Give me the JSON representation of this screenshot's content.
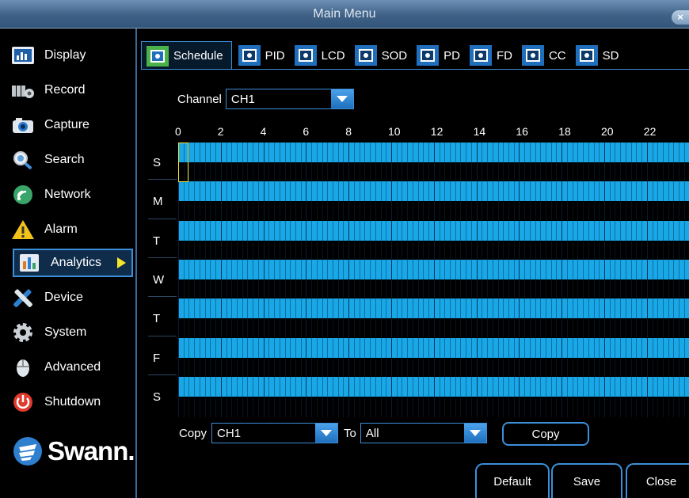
{
  "window": {
    "title": "Main Menu",
    "close_label": "×"
  },
  "sidebar": {
    "items": [
      {
        "label": "Display",
        "icon": "display-icon"
      },
      {
        "label": "Record",
        "icon": "record-icon"
      },
      {
        "label": "Capture",
        "icon": "camera-icon"
      },
      {
        "label": "Search",
        "icon": "search-icon"
      },
      {
        "label": "Network",
        "icon": "network-icon"
      },
      {
        "label": "Alarm",
        "icon": "alarm-icon"
      },
      {
        "label": "Analytics",
        "icon": "analytics-icon",
        "active": true
      },
      {
        "label": "Device",
        "icon": "tools-icon"
      },
      {
        "label": "System",
        "icon": "gear-icon"
      },
      {
        "label": "Advanced",
        "icon": "mouse-icon"
      },
      {
        "label": "Shutdown",
        "icon": "power-icon"
      }
    ],
    "logo_text": "Swann",
    "logo_suffix": "."
  },
  "tabs": [
    {
      "label": "Schedule",
      "active": true
    },
    {
      "label": "PID"
    },
    {
      "label": "LCD"
    },
    {
      "label": "SOD"
    },
    {
      "label": "PD"
    },
    {
      "label": "FD"
    },
    {
      "label": "CC"
    },
    {
      "label": "SD"
    }
  ],
  "schedule": {
    "channel_label": "Channel",
    "channel_value": "CH1",
    "hour_labels": [
      "0",
      "2",
      "4",
      "6",
      "8",
      "10",
      "12",
      "14",
      "16",
      "18",
      "20",
      "22"
    ],
    "days": [
      "S",
      "M",
      "T",
      "W",
      "T",
      "F",
      "S"
    ],
    "all_hours_scheduled": true
  },
  "copy": {
    "copy_label": "Copy",
    "from_value": "CH1",
    "to_label": "To",
    "to_value": "All",
    "copy_button": "Copy"
  },
  "footer": {
    "default_button": "Default",
    "save_button": "Save",
    "close_button": "Close"
  },
  "colors": {
    "accent": "#3c8fd8",
    "schedule_fill": "#18a8e8",
    "title_bar": "#4a6c92",
    "cursor": "#f2e23b"
  }
}
